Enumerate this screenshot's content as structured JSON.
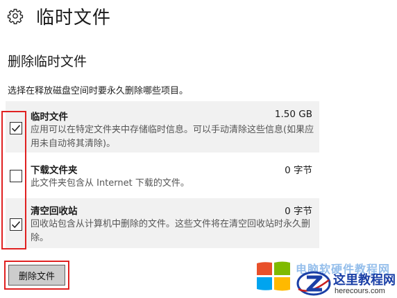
{
  "header": {
    "title": "临时文件",
    "icon": "gear-icon"
  },
  "section": {
    "title": "删除临时文件",
    "instruction": "选择在释放磁盘空间时要永久删除哪些项目。"
  },
  "items": [
    {
      "name": "临时文件",
      "size": "1.50 GB",
      "description": "应用可以在特定文件夹中存储临时信息。可以手动清除这些信息(如果应用未自动将其清除)。",
      "checked": true
    },
    {
      "name": "下载文件夹",
      "size": "0 字节",
      "description": "此文件夹包含从 Internet 下载的文件。",
      "checked": false
    },
    {
      "name": "清空回收站",
      "size": "0 字节",
      "description": "回收站包含从计算机中删除的文件。这些文件将在清空回收站时永久删除。",
      "checked": true
    }
  ],
  "actions": {
    "delete_label": "删除文件"
  },
  "annotation_color": "#e02020",
  "watermark": {
    "top_text": "电脑软硬件教程网",
    "main_text": "这里教程网",
    "domain": "herecours.com",
    "logo_colors": [
      "#e8502a",
      "#7fba00",
      "#00a4ef",
      "#ffb900"
    ]
  }
}
